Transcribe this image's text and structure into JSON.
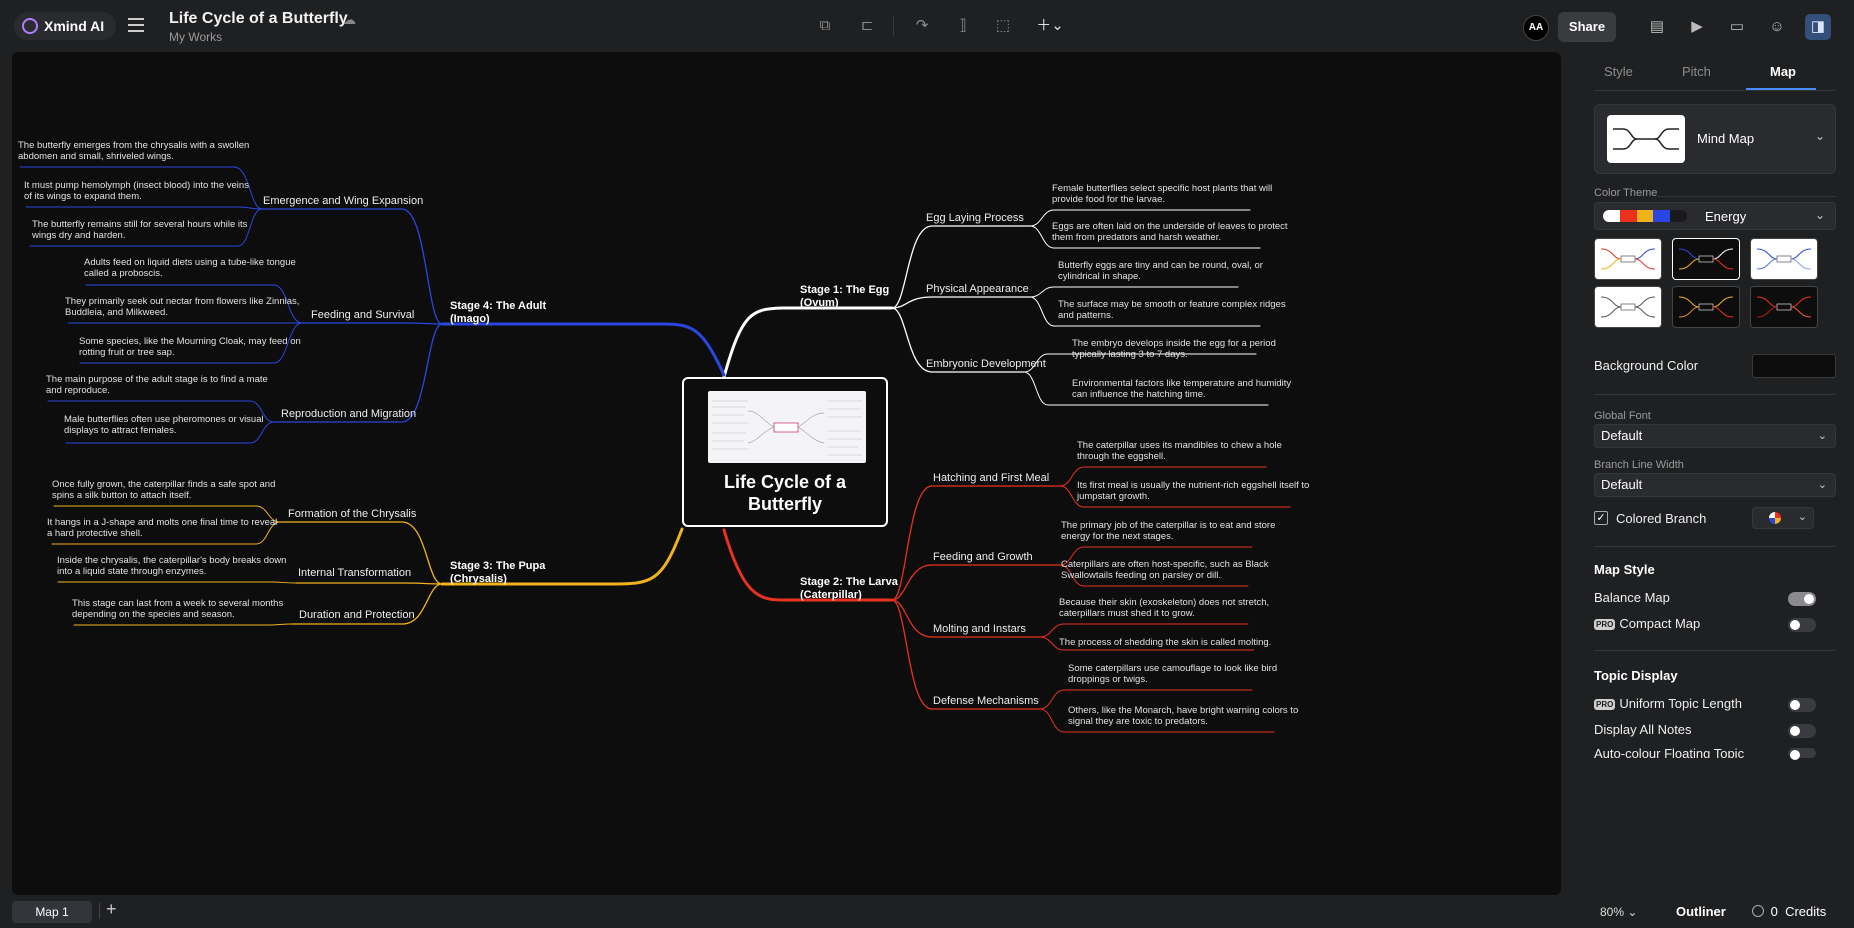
{
  "app": {
    "brand": "Xmind AI",
    "title": "Life Cycle of a Butterfly",
    "subtitle": "My Works",
    "avatar": "AA",
    "share": "Share"
  },
  "map": {
    "central": {
      "line1": "Life Cycle of a",
      "line2": "Butterfly"
    },
    "stages": {
      "s1": {
        "line1": "Stage 1: The Egg",
        "line2": "(Ovum)"
      },
      "s2": {
        "line1": "Stage 2: The Larva",
        "line2": "(Caterpillar)"
      },
      "s3": {
        "line1": "Stage 3: The Pupa",
        "line2": "(Chrysalis)"
      },
      "s4": {
        "line1": "Stage 4: The Adult",
        "line2": "(Imago)"
      }
    },
    "topics": {
      "egg_laying": "Egg Laying Process",
      "physical": "Physical Appearance",
      "embryonic": "Embryonic Development",
      "hatching": "Hatching and First Meal",
      "feeding_growth": "Feeding and Growth",
      "molting": "Molting and Instars",
      "defense": "Defense Mechanisms",
      "formation": "Formation of the Chrysalis",
      "internal": "Internal Transformation",
      "duration": "Duration and Protection",
      "emergence": "Emergence and Wing Expansion",
      "feeding_survival": "Feeding and Survival",
      "reproduction": "Reproduction and Migration"
    },
    "notes": {
      "n1a": "Female butterflies select specific host plants that will",
      "n1b": "provide food for the larvae.",
      "n2a": "Eggs are often laid on the underside of leaves to protect",
      "n2b": "them from predators and harsh weather.",
      "n3a": "Butterfly eggs are tiny and can be round, oval, or",
      "n3b": "cylindrical in shape.",
      "n4a": "The surface may be smooth or feature complex ridges",
      "n4b": "and patterns.",
      "n5a": "The embryo develops inside the egg for a period",
      "n5b": "typically lasting 3 to 7 days.",
      "n6a": "Environmental factors like temperature and humidity",
      "n6b": "can influence the hatching time.",
      "n7a": "The caterpillar uses its mandibles to chew a hole",
      "n7b": "through the eggshell.",
      "n8a": "Its first meal is usually the nutrient-rich eggshell itself to",
      "n8b": "jumpstart growth.",
      "n9a": "The primary job of the caterpillar is to eat and store",
      "n9b": "energy for the next stages.",
      "n10a": "Caterpillars are often host-specific, such as Black",
      "n10b": "Swallowtails feeding on parsley or dill.",
      "n11a": "Because their skin (exoskeleton) does not stretch,",
      "n11b": "caterpillars must shed it to grow.",
      "n12a": "The process of shedding the skin is called molting.",
      "n13a": "Some caterpillars use camouflage to look like bird",
      "n13b": "droppings or twigs.",
      "n14a": "Others, like the Monarch, have bright warning colors to",
      "n14b": "signal they are toxic to predators.",
      "n15a": "Once fully grown, the caterpillar finds a safe spot and",
      "n15b": "spins a silk button to attach itself.",
      "n16a": "It hangs in a J-shape and molts one final time to reveal",
      "n16b": "a hard protective shell.",
      "n17a": "Inside the chrysalis, the caterpillar's body breaks down",
      "n17b": "into a liquid state through enzymes.",
      "n18a": "This stage can last from a week to several months",
      "n18b": "depending on the species and season.",
      "n19a": "The butterfly emerges from the chrysalis with a swollen",
      "n19b": "abdomen and small, shriveled wings.",
      "n20a": "It must pump hemolymph (insect blood) into the veins",
      "n20b": "of its wings to expand them.",
      "n21a": "The butterfly remains still for several hours while its",
      "n21b": "wings dry and harden.",
      "n22a": "Adults feed on liquid diets using a tube-like tongue",
      "n22b": "called a proboscis.",
      "n23a": "They primarily seek out nectar from flowers like Zinnias,",
      "n23b": "Buddleia, and Milkweed.",
      "n24a": "Some species, like the Mourning Cloak, may feed on",
      "n24b": "rotting fruit or tree sap.",
      "n25a": "The main purpose of the adult stage is to find a mate",
      "n25b": "and reproduce.",
      "n26a": "Male butterflies often use pheromones or visual",
      "n26b": "displays to attract females."
    },
    "colors": {
      "egg": "#ffffff",
      "larva": "#e8321e",
      "pupa": "#f2b21b",
      "adult": "#2a46e0"
    }
  },
  "panel": {
    "tabs": [
      "Style",
      "Pitch",
      "Map"
    ],
    "structure": "Mind Map",
    "color_theme_label": "Color Theme",
    "color_theme": "Energy",
    "theme_swatches": [
      "#ffffff",
      "#e8321e",
      "#f2b21b",
      "#2a46e0",
      "#1a1a1a"
    ],
    "background_color_label": "Background Color",
    "global_font_label": "Global Font",
    "global_font": "Default",
    "branch_line_width_label": "Branch Line Width",
    "branch_line_width": "Default",
    "colored_branch": "Colored Branch",
    "map_style": "Map Style",
    "balance_map": "Balance Map",
    "compact_map": "Compact Map",
    "topic_display": "Topic Display",
    "uniform_topic_length": "Uniform Topic Length",
    "display_all_notes": "Display All Notes",
    "auto_colour": "Auto-colour Floating Topic",
    "pro": "PRO"
  },
  "bottom": {
    "map_tab": "Map 1",
    "zoom": "80%",
    "outliner": "Outliner",
    "credits_count": "0",
    "credits_label": "Credits"
  }
}
